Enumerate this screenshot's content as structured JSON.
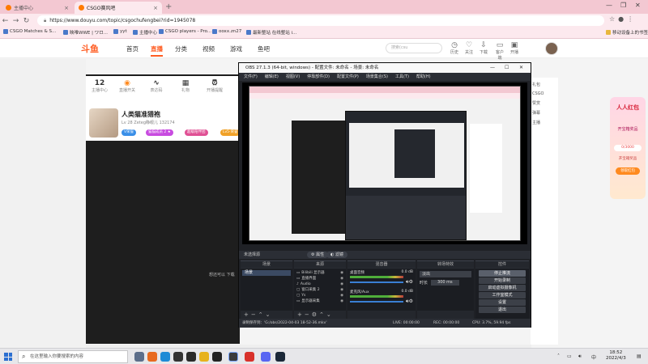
{
  "browser": {
    "tabs": [
      {
        "label": "主播中心",
        "active": false
      },
      {
        "label": "CSGO赛风吧",
        "active": true
      }
    ],
    "url": "https://www.douyu.com/topic/csgochufengbei?rid=1945078",
    "bookmarks": [
      "CSGO Matches & S...",
      "映唯WWE | ワロ...",
      "yyt",
      "主播中心",
      "CSGO players - Pro...",
      "ooxx.zn27",
      "最新整站 在线整站 i...",
      "移动设备上的书签"
    ]
  },
  "douyu": {
    "nav": [
      "首页",
      "直播",
      "分类",
      "视频",
      "游戏",
      "鱼吧"
    ],
    "search_placeholder": "搜索(csu",
    "header_icons": [
      "历史",
      "关注",
      "下载",
      "客户端",
      "开播"
    ],
    "stats": [
      {
        "value": "12",
        "label": "主播中心"
      },
      {
        "value": "",
        "label": "直播开关"
      },
      {
        "value": "",
        "label": "表达码"
      },
      {
        "value": "",
        "label": "礼物"
      },
      {
        "value": "",
        "label": "开播提醒"
      }
    ],
    "streamer": {
      "name": "人类猫准猎袍",
      "meta_line": "Lv 28 Zeteg睁眼儿  132174",
      "badges": [
        "V荣誉",
        "猫猫成员 2 ★",
        "超级陪伴团",
        "Lv5·荣誉"
      ]
    },
    "right_col": [
      "礼包",
      "CSGO",
      "赞赏",
      "弹幕",
      "主播"
    ],
    "desktop_text": "想还可以 下载",
    "promo": {
      "title": "人人红包",
      "subtitle": "开宝箱奖品",
      "progress_text": "0/3000",
      "desc": "开宝箱奖品",
      "button": "领取红包"
    }
  },
  "obs": {
    "title": "OBS 27.1.3 (64-bit, windows) - 配置文件: 未命名 - 场景: 未命名",
    "menu": [
      "文件(F)",
      "编辑(E)",
      "视图(V)",
      "停靠部件(D)",
      "配置文件(P)",
      "场景集合(S)",
      "工具(T)",
      "帮助(H)"
    ],
    "scene_toolbar": {
      "label": "未选择源",
      "properties": "属性",
      "filters": "滤镜"
    },
    "docks": {
      "scenes": {
        "title": "场景",
        "items": [
          "场景"
        ]
      },
      "sources": {
        "title": "来源",
        "items": [
          "Bilibili 显示器",
          "直播界面",
          "Audio",
          "窗口采集 2",
          "Ys",
          "显示器采集"
        ]
      },
      "mixer": {
        "title": "混音器",
        "channels": [
          {
            "name": "桌面音频",
            "level": "0.0 dB"
          },
          {
            "name": "麦克风/Aux",
            "level": "0.0 dB"
          }
        ]
      },
      "transitions": {
        "title": "转场特效",
        "type": "淡出",
        "duration_label": "时长",
        "duration": "300 ms"
      },
      "controls": {
        "title": "控件",
        "buttons": [
          "停止推流",
          "开始录制",
          "启动虚拟摄像机",
          "工作室模式",
          "设置",
          "退出"
        ]
      }
    },
    "status": {
      "recording": "录制保存到：'G:/obs/2022-04-03 18-52-36.mkv'",
      "live": "LIVE: 00:00:00",
      "rec": "REC: 00:00:00",
      "cpu": "CPU: 3.7%, 59.94 fps"
    }
  },
  "taskbar": {
    "search_placeholder": "在这里输入你要搜索的内容",
    "time": "18:52",
    "date": "2022/4/3",
    "input_lang": "中"
  }
}
